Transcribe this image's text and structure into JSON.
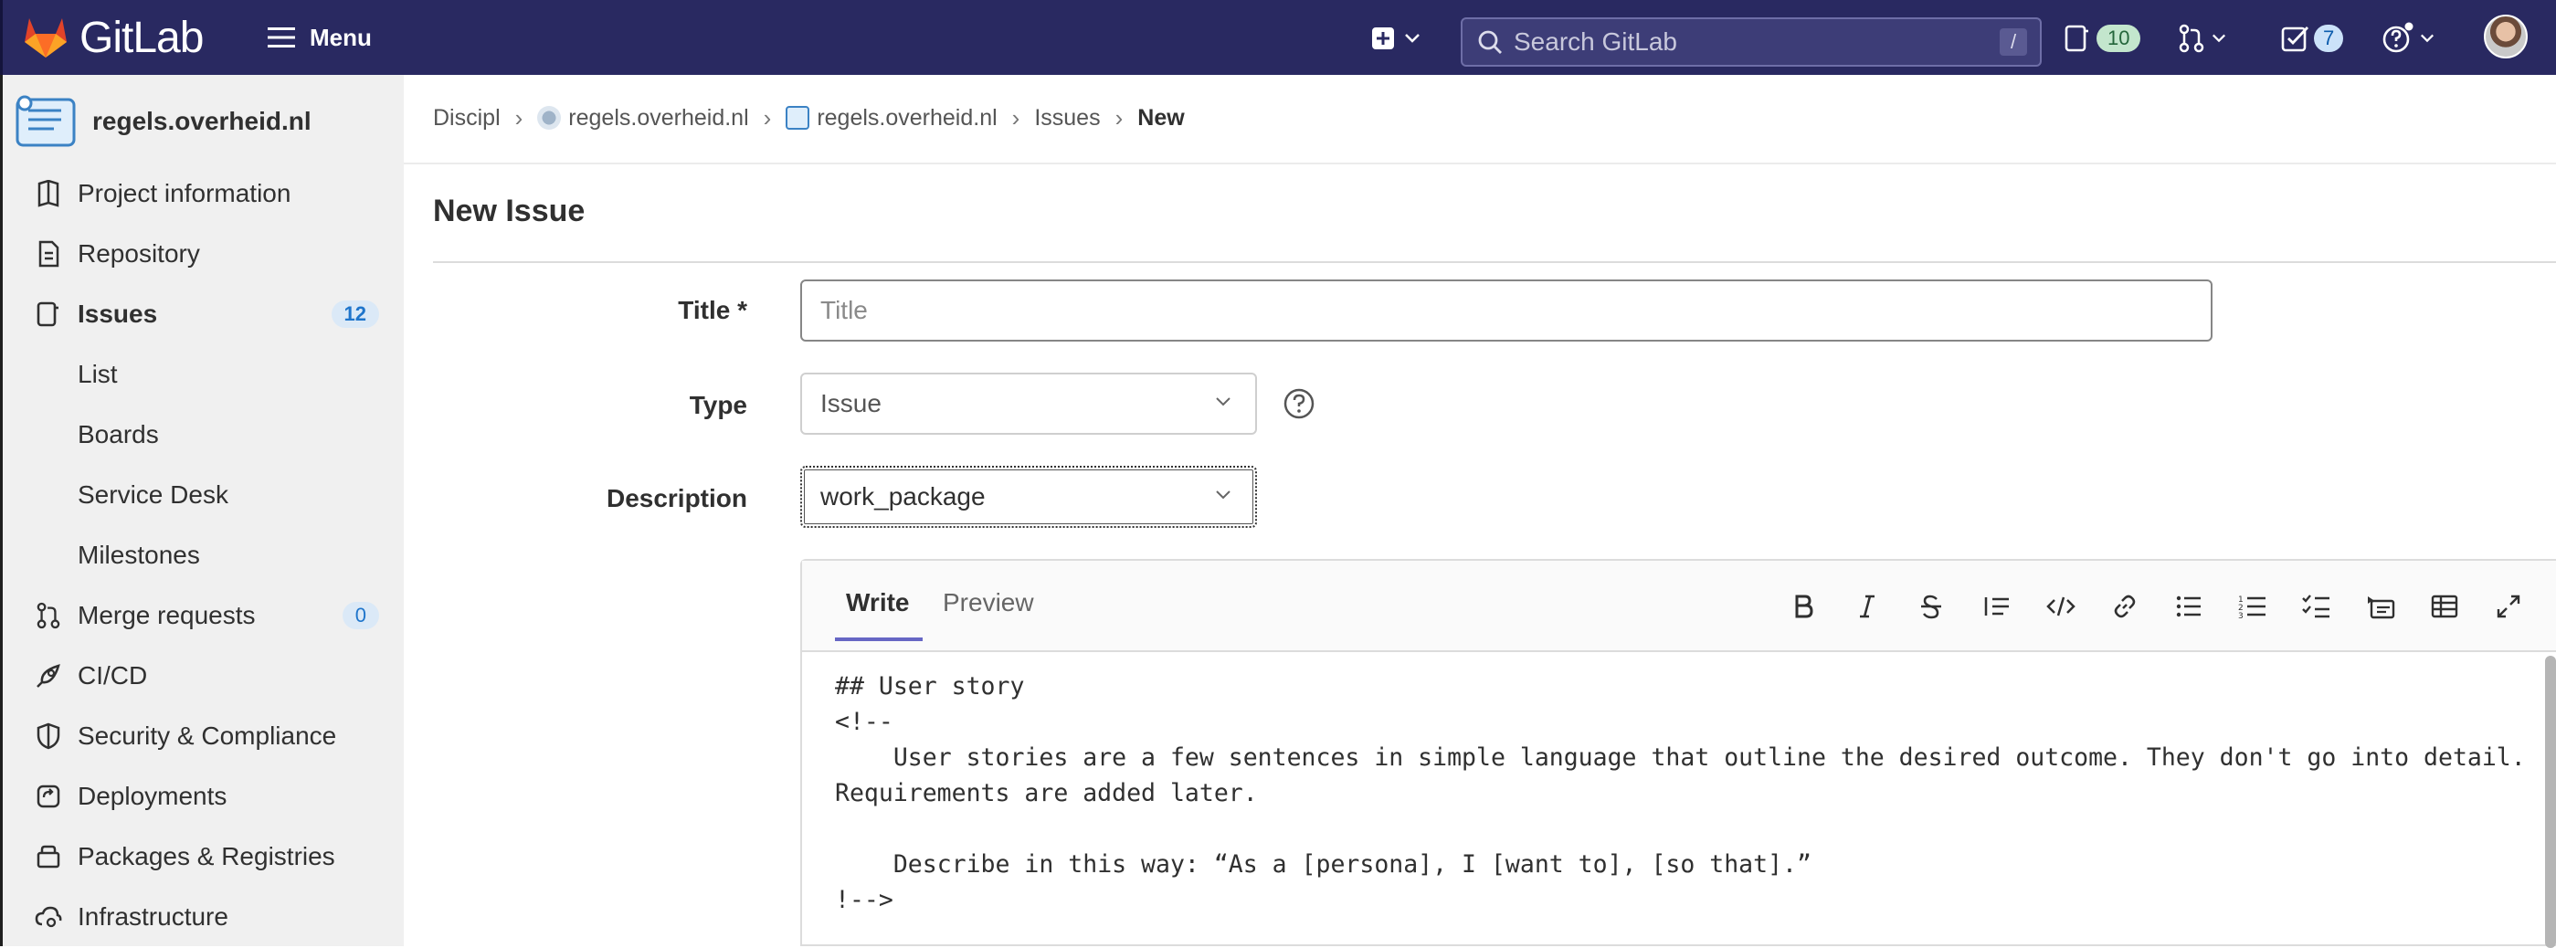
{
  "topbar": {
    "logo_text": "GitLab",
    "menu_label": "Menu",
    "search_placeholder": "Search GitLab",
    "search_shortcut": "/",
    "issues_count": "10",
    "todos_count": "7"
  },
  "sidebar": {
    "project_name": "regels.overheid.nl",
    "items": [
      {
        "label": "Project information",
        "icon": "project-info-icon"
      },
      {
        "label": "Repository",
        "icon": "repository-icon"
      },
      {
        "label": "Issues",
        "icon": "issues-icon",
        "count": "12"
      },
      {
        "label": "List"
      },
      {
        "label": "Boards"
      },
      {
        "label": "Service Desk"
      },
      {
        "label": "Milestones"
      },
      {
        "label": "Merge requests",
        "icon": "merge-request-icon",
        "count": "0"
      },
      {
        "label": "CI/CD",
        "icon": "rocket-icon"
      },
      {
        "label": "Security & Compliance",
        "icon": "shield-icon"
      },
      {
        "label": "Deployments",
        "icon": "deployments-icon"
      },
      {
        "label": "Packages & Registries",
        "icon": "package-icon"
      },
      {
        "label": "Infrastructure",
        "icon": "cloud-gear-icon"
      }
    ]
  },
  "breadcrumb": [
    "Discipl",
    "regels.overheid.nl",
    "regels.overheid.nl",
    "Issues",
    "New"
  ],
  "page_title": "New Issue",
  "form": {
    "title_label": "Title *",
    "title_placeholder": "Title",
    "title_value": "",
    "type_label": "Type",
    "type_value": "Issue",
    "description_label": "Description",
    "template_value": "work_package"
  },
  "editor": {
    "tab_write": "Write",
    "tab_preview": "Preview",
    "toolbar": [
      "bold-icon",
      "italic-icon",
      "strikethrough-icon",
      "quote-icon",
      "code-icon",
      "link-icon",
      "bulleted-list-icon",
      "numbered-list-icon",
      "task-list-icon",
      "collapsible-icon",
      "table-icon",
      "fullscreen-icon"
    ],
    "content": "## User story\n<!--\n    User stories are a few sentences in simple language that outline the desired outcome. They don't go into detail.\nRequirements are added later.\n\n    Describe in this way: “As a [persona], I [want to], [so that].”\n!-->"
  },
  "colors": {
    "topbar_bg": "#292961",
    "sidebar_bg": "#f0f0f0",
    "tab_underline": "#6666c4",
    "badge_blue": "#dbe9f7"
  }
}
